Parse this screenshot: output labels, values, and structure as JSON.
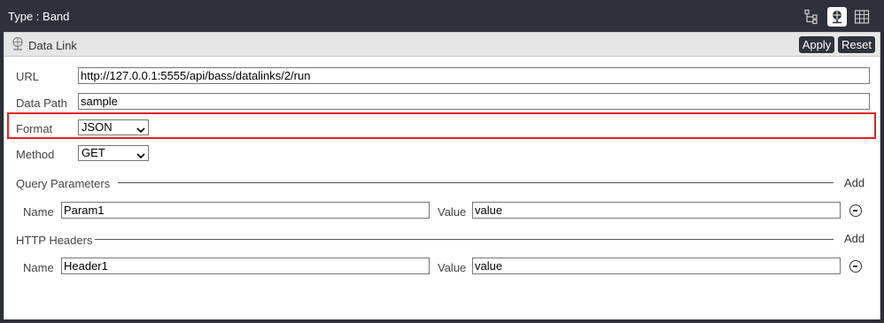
{
  "titlebar": {
    "title": "Type : Band"
  },
  "toolbar": {
    "icons": [
      "hierarchy-icon",
      "data-link-icon",
      "grid-icon"
    ]
  },
  "subheader": {
    "label": "Data Link",
    "apply_label": "Apply",
    "reset_label": "Reset"
  },
  "form": {
    "url_label": "URL",
    "url_value": "http://127.0.0.1:5555/api/bass/datalinks/2/run",
    "data_path_label": "Data Path",
    "data_path_value": "sample",
    "format_label": "Format",
    "format_value": "JSON",
    "method_label": "Method",
    "method_value": "GET"
  },
  "query_params": {
    "title": "Query Parameters",
    "add_label": "Add",
    "rows": [
      {
        "name_label": "Name",
        "name_value": "Param1",
        "value_label": "Value",
        "value_value": "value"
      }
    ]
  },
  "http_headers": {
    "title": "HTTP Headers",
    "add_label": "Add",
    "rows": [
      {
        "name_label": "Name",
        "name_value": "Header1",
        "value_label": "Value",
        "value_value": "value"
      }
    ]
  },
  "colors": {
    "titlebar_bg": "#2d3139",
    "highlight_border": "#e02020",
    "button_bg": "#2f333b"
  }
}
